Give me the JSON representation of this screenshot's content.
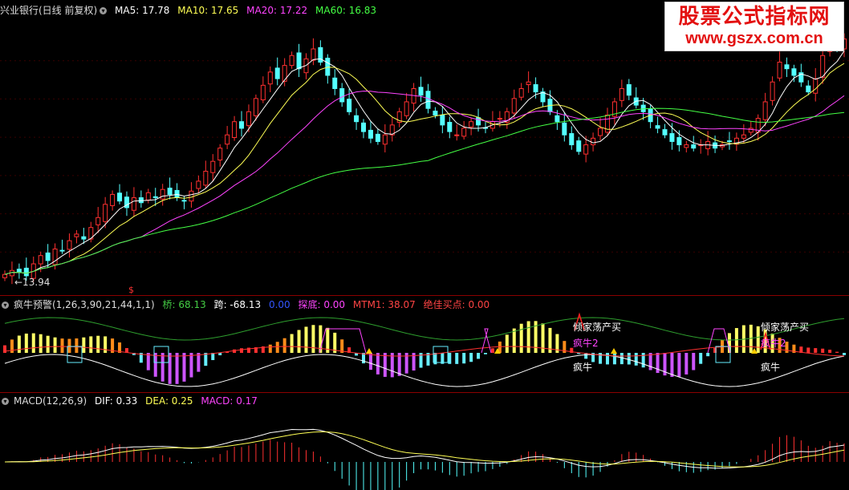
{
  "watermark": {
    "title": "股票公式指标网",
    "url": "www.gszx.com.cn"
  },
  "price_panel": {
    "title": "兴业银行(日线 前复权)",
    "ma": [
      {
        "label": "MA5: 17.78",
        "color": "#ffffff"
      },
      {
        "label": "MA10: 17.65",
        "color": "#ffff55"
      },
      {
        "label": "MA20: 17.22",
        "color": "#ff44ff"
      },
      {
        "label": "MA60: 16.83",
        "color": "#44ff44"
      }
    ],
    "low_label": "←13.94",
    "marker": "$"
  },
  "indicator_panel": {
    "title": "疯牛预警(1,26,3,90,21,44,1,1)",
    "items": [
      {
        "label": "桥: 68.13",
        "color": "#44cc44"
      },
      {
        "label": "跨: -68.13",
        "color": "#ffffff"
      },
      {
        "label": "0.00",
        "color": "#3355ff"
      },
      {
        "label": "探底: 0.00",
        "color": "#ff44ff"
      },
      {
        "label": "MTM1: 38.07",
        "color": "#ff4444"
      },
      {
        "label": "绝佳买点: 0.00",
        "color": "#ff4444"
      }
    ],
    "signals": [
      {
        "text": "倾家荡产买",
        "color": "#ffffff"
      },
      {
        "text": "疯牛2",
        "color": "#ff44ff"
      },
      {
        "text": "疯牛",
        "color": "#ffffff"
      },
      {
        "text": "倾家荡产买",
        "color": "#ffffff"
      },
      {
        "text": "疯牛2",
        "color": "#ff44ff"
      },
      {
        "text": "疯牛",
        "color": "#ffffff"
      }
    ]
  },
  "macd_panel": {
    "title": "MACD(12,26,9)",
    "items": [
      {
        "label": "DIF: 0.33",
        "color": "#ffffff"
      },
      {
        "label": "DEA: 0.25",
        "color": "#ffff55"
      },
      {
        "label": "MACD: 0.17",
        "color": "#ff44ff"
      }
    ]
  },
  "chart_data": {
    "type": "candlestick",
    "ma_windows": [
      5,
      10,
      20,
      60
    ],
    "price_range": [
      13.5,
      21.6
    ],
    "closes": [
      13.98,
      14.1,
      14.05,
      13.94,
      14.3,
      14.55,
      14.4,
      14.75,
      14.7,
      15.0,
      15.2,
      15.05,
      15.4,
      15.7,
      16.1,
      16.4,
      16.2,
      16.0,
      16.3,
      16.15,
      16.45,
      16.3,
      16.55,
      16.4,
      16.3,
      16.2,
      16.5,
      16.8,
      17.1,
      17.4,
      17.8,
      18.2,
      18.6,
      18.4,
      18.9,
      19.3,
      19.7,
      20.1,
      19.9,
      20.3,
      20.6,
      20.2,
      20.5,
      20.8,
      20.4,
      20.0,
      19.6,
      19.2,
      18.9,
      18.6,
      18.3,
      18.1,
      18.0,
      18.2,
      18.5,
      18.9,
      19.2,
      19.6,
      19.4,
      19.0,
      18.8,
      18.5,
      18.3,
      18.2,
      18.4,
      18.6,
      18.5,
      18.4,
      18.6,
      18.7,
      18.9,
      19.3,
      19.6,
      19.8,
      19.5,
      19.2,
      18.9,
      18.6,
      18.2,
      17.9,
      17.7,
      17.9,
      18.1,
      18.4,
      18.8,
      19.2,
      19.6,
      19.4,
      19.1,
      18.9,
      18.6,
      18.4,
      18.2,
      18.0,
      17.9,
      17.9,
      17.8,
      17.9,
      18.0,
      17.8,
      17.9,
      18.0,
      18.1,
      18.2,
      18.4,
      18.7,
      19.2,
      19.8,
      20.4,
      20.2,
      20.0,
      19.8,
      19.5,
      19.9,
      20.6,
      21.3,
      20.8,
      21.1
    ]
  }
}
